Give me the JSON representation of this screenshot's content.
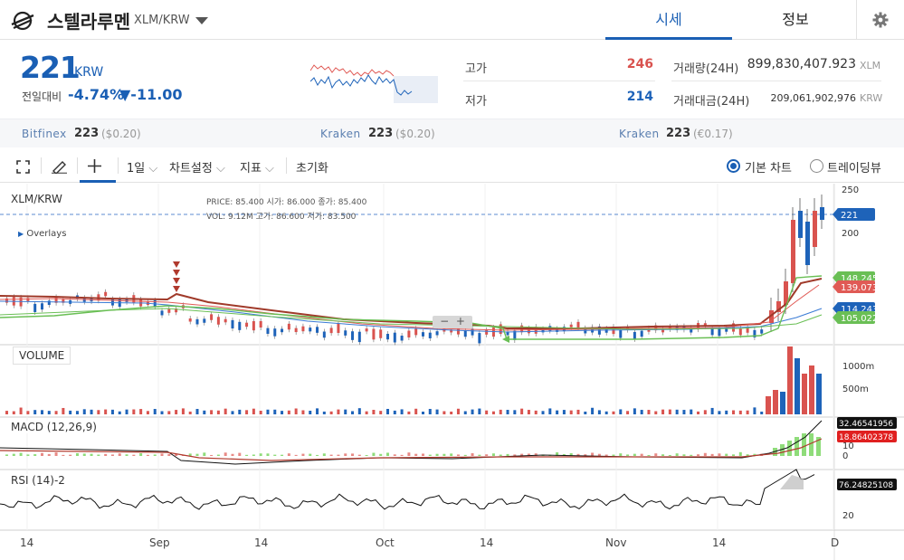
{
  "header": {
    "coin_name": "스텔라루멘",
    "pair": "XLM/KRW",
    "tabs": [
      {
        "label": "시세"
      },
      {
        "label": "정보"
      }
    ]
  },
  "price": {
    "current": "221",
    "unit": "KRW",
    "change_label": "전일대비",
    "change_pct": "-4.74%",
    "change_abs": "▼-11.00"
  },
  "stats": {
    "high_label": "고가",
    "high": "246",
    "low_label": "저가",
    "low": "214",
    "volume_label": "거래량(24H)",
    "volume": "899,830,407.923",
    "volume_unit": "XLM",
    "amount_label": "거래대금(24H)",
    "amount": "209,061,902,976",
    "amount_unit": "KRW"
  },
  "exchanges": [
    {
      "name": "Bitfinex",
      "price": "223",
      "ref": "($0.20)"
    },
    {
      "name": "Kraken",
      "price": "223",
      "ref": "($0.20)"
    },
    {
      "name": "Kraken",
      "price": "223",
      "ref": "(€0.17)"
    }
  ],
  "toolbar": {
    "interval": "1일",
    "chart_settings": "차트설정",
    "indicators": "지표",
    "reset": "초기화",
    "basic_chart": "기본 차트",
    "tradingview": "트레이딩뷰"
  },
  "chart": {
    "symbol": "XLM/KRW",
    "overlays": "Overlays",
    "info_row1": "PRICE: 85.400   시가: 86.000   종가: 85.400",
    "info_row2": "VOL: 9.12M   고가: 86.600   저가: 83.500",
    "price_badges": [
      "221",
      "148.245",
      "139.073",
      "114.243",
      "105.022"
    ],
    "price_ticks": [
      "250",
      "200"
    ],
    "volume_label": "VOLUME",
    "volume_ticks": [
      "1000m",
      "500m"
    ],
    "macd_label": "MACD (12,26,9)",
    "macd_badges": [
      "32.46541956",
      "18.86402378"
    ],
    "macd_ticks": [
      "10",
      "0"
    ],
    "rsi_label": "RSI (14)-2",
    "rsi_badge": "76.24825108",
    "rsi_ticks": [
      "20"
    ],
    "x_ticks": [
      "14",
      "Sep",
      "14",
      "Oct",
      "14",
      "Nov",
      "14",
      "D"
    ],
    "colors": {
      "up": "#d9534f",
      "down": "#1e63b9",
      "accent": "#1a5fb4"
    }
  }
}
